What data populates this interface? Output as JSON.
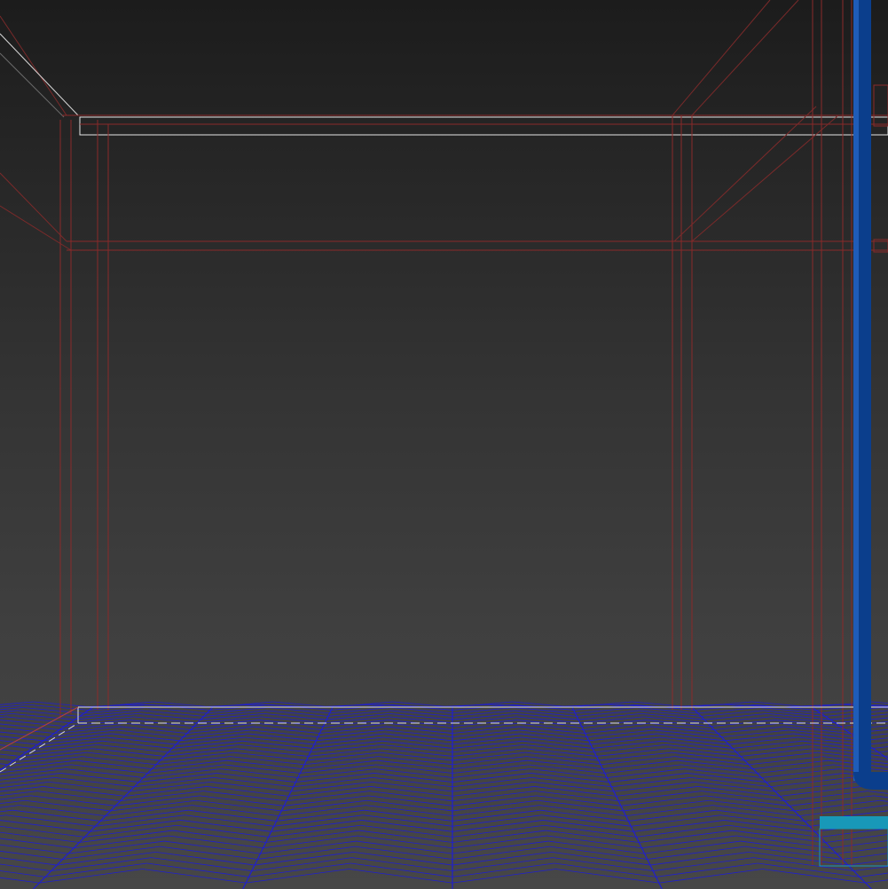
{
  "viewport": {
    "name": "3d-perspective-viewport",
    "background_top": "#1b1b1b",
    "background_bottom": "#484848"
  },
  "colors": {
    "wire_frame": "#8a2a2a",
    "wire_frame_bright": "#b04040",
    "wire_selected": "#e6e6e6",
    "floor_wire": "#1f1fd0",
    "pipe_blue": "#0b3e8c",
    "pipe_cyan": "#1898b8"
  },
  "objects": [
    {
      "name": "wall-frame",
      "type": "wireframe"
    },
    {
      "name": "ceiling-beam",
      "type": "wireframe"
    },
    {
      "name": "herringbone-floor",
      "type": "wireframe"
    },
    {
      "name": "vertical-pipe",
      "type": "solid"
    },
    {
      "name": "horizontal-pipe",
      "type": "solid"
    }
  ]
}
